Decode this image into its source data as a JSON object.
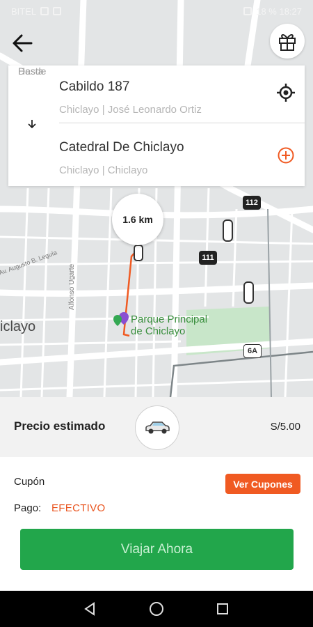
{
  "status_bar": {
    "left_text": "BITEL",
    "right_text": "18 % 18:27"
  },
  "header": {
    "back_icon": "arrow-left-icon",
    "gift_icon": "gift-icon"
  },
  "route": {
    "from_label": "Desde",
    "from_title": "Cabildo 187",
    "from_subtitle": "Chiclayo | José Leonardo Ortiz",
    "to_label": "Hasta",
    "to_title": "Catedral De Chiclayo",
    "to_subtitle": "Chiclayo | Chiclayo",
    "locate_icon": "crosshair-icon",
    "add_icon": "plus-circle-icon",
    "swap_icon": "arrow-down-icon"
  },
  "map": {
    "distance": "1.6 km",
    "city_label": "iclayo",
    "park_label_line1": "Parque Principal",
    "park_label_line2": "de Chiclayo",
    "street_label_1": "Alfonso Ugarte",
    "street_label_2": "Av. Augusto B. Leguía",
    "shields": [
      "112",
      "111",
      "6A"
    ],
    "route_color": "#f05a22",
    "park_color": "#c8e6c9"
  },
  "price": {
    "label": "Precio estimado",
    "value": "S/5.00",
    "car_icon": "car-icon"
  },
  "coupon": {
    "label": "Cupón",
    "button_label": "Ver Cupones"
  },
  "payment": {
    "label": "Pago:",
    "value": "EFECTIVO"
  },
  "action": {
    "button_label": "Viajar Ahora",
    "button_color": "#22a64b"
  },
  "accent_color": "#f05a22"
}
